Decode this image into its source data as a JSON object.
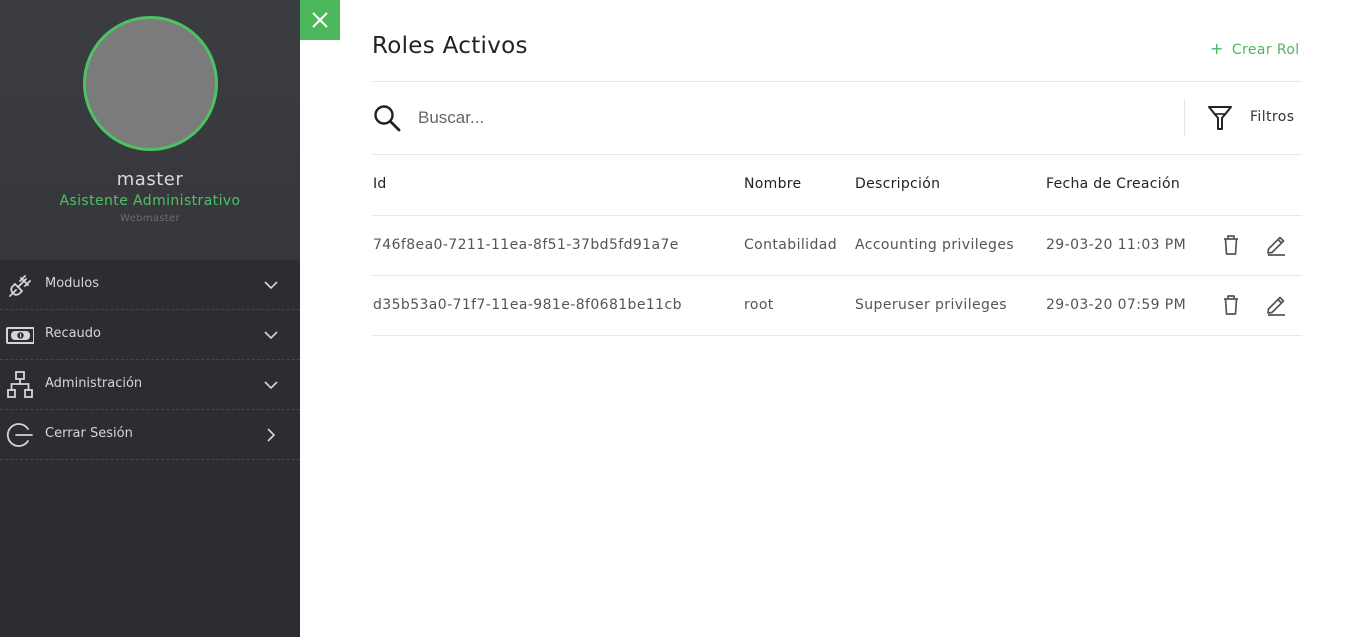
{
  "user": {
    "name": "master",
    "role": "Asistente Administrativo",
    "type": "Webmaster"
  },
  "menu": {
    "items": [
      {
        "label": "Modulos",
        "icon": "plug-icon",
        "chevron": "chevron-down-icon"
      },
      {
        "label": "Recaudo",
        "icon": "money-icon",
        "chevron": "chevron-down-icon"
      },
      {
        "label": "Administración",
        "icon": "hierarchy-icon",
        "chevron": "chevron-down-icon"
      },
      {
        "label": "Cerrar Sesión",
        "icon": "logout-icon",
        "chevron": "chevron-right-icon"
      }
    ]
  },
  "header": {
    "title": "Roles Activos",
    "create_label": "Crear Rol",
    "create_icon": "plus-icon"
  },
  "search": {
    "placeholder": "Buscar...",
    "filter_label": "Filtros"
  },
  "table": {
    "columns": [
      "Id",
      "Nombre",
      "Descripción",
      "Fecha de Creación"
    ],
    "rows": [
      {
        "id": "746f8ea0-7211-11ea-8f51-37bd5fd91a7e",
        "nombre": "Contabilidad",
        "descripcion": "Accounting privileges",
        "fecha": "29-03-20 11:03 PM"
      },
      {
        "id": "d35b53a0-71f7-11ea-981e-8f0681be11cb",
        "nombre": "root",
        "descripcion": "Superuser privileges",
        "fecha": "29-03-20 07:59 PM"
      }
    ]
  },
  "colors": {
    "accent": "#4cb85e",
    "sidebar_bg": "#2b2d31",
    "profile_bg": "#3b3d42"
  }
}
